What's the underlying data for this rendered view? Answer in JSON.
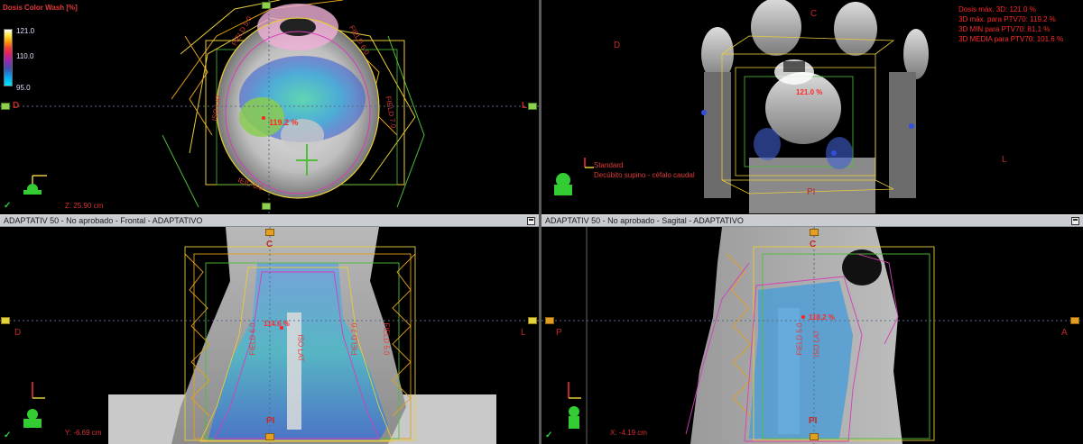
{
  "axial": {
    "legend_title": "Dosis Color Wash [%]",
    "legend_max": "121.0",
    "legend_mid": "110.0",
    "legend_min": "95.0",
    "orient_left": "D",
    "orient_right": "L",
    "coord": "Z: 25.90 cm",
    "dose_label": "119.2 %",
    "field_labels": [
      "FIELD 5.0",
      "FIELD 6.0",
      "FIELD 7.0",
      "ISO LAT",
      "IEID 6.0",
      "FIELD 5.0",
      "FIELD 8.0"
    ],
    "check": "✓"
  },
  "view3d": {
    "orient_d": "D",
    "orient_c": "C",
    "orient_l": "L",
    "orient_pi": "PI",
    "dose_label": "121.0 %",
    "preset": "Standard",
    "position": "Decúbito supino - céfalo caudal",
    "stats": [
      "Dosis máx. 3D: 121.0 %",
      "3D máx. para PTV70: 119.2 %",
      "3D MIN para PTV70: 81.1 %",
      "3D MEDIA para PTV70: 101.6 %"
    ]
  },
  "frontal": {
    "title": "ADAPTATIV 50  -  No aprobado - Frontal - ADAPTATIVO",
    "orient_top": "C",
    "orient_left": "D",
    "orient_right": "L",
    "orient_bottom": "PI",
    "coord": "Y: -6.69 cm",
    "dose_label": "114.6 %",
    "field_labels": [
      "FIELD 7.0",
      "FIELD 5.0",
      "FIELD 6.0",
      "ISO LAT"
    ],
    "check": "✓"
  },
  "sagittal": {
    "title": "ADAPTATIV 50  -  No aprobado - Sagital - ADAPTATIVO",
    "orient_top": "C",
    "orient_left": "P",
    "orient_right": "A",
    "orient_bottom": "PI",
    "coord": "X: -4.19 cm",
    "dose_label": "118.2 %",
    "field_labels": [
      "FIELD 5.0",
      "ISO LAT"
    ],
    "check": "✓"
  },
  "colors": {
    "dose_high": "#ff3b3b",
    "dose_mid": "#3fb8d9",
    "contour_yellow": "#e8cc3a",
    "contour_green": "#4fbf3a",
    "ptv_magenta": "#d43fb8",
    "orientation_text": "#c42828"
  }
}
